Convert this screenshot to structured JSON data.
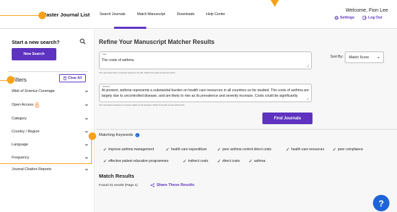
{
  "header": {
    "brand": "Master Journal List",
    "nav": [
      "Search Journals",
      "Match Manuscript",
      "Downloads",
      "Help Center"
    ],
    "welcome": "Welcome, Fion Lee",
    "settings": "Settings",
    "logout": "Log Out"
  },
  "sidebar": {
    "new_search_title": "Start a new search?",
    "new_search_button": "New Search",
    "filters_title": "Filters",
    "clear_all": "Clear All",
    "filters": [
      {
        "label": "Web of Science Coverage",
        "italic": true
      },
      {
        "label": "Open Access",
        "icon": "open-lock-icon"
      },
      {
        "label": "Category"
      },
      {
        "label": "Country / Region"
      },
      {
        "label": "Language"
      },
      {
        "label": "Frequency"
      },
      {
        "label": "Journal Citation Reports"
      }
    ]
  },
  "main": {
    "title": "Refine Your Manuscript Matcher Results",
    "title_field": {
      "label": "Title",
      "value": "The costs of asthma",
      "help": "The manuscript title or relevant part(s) of the title. Works best with at least 10 words."
    },
    "abstract_field": {
      "label": "Abstract",
      "value": "At present, asthma represents a substantial burden on health care resources in all countries so far studied. The costs of asthma are largely due to uncontrolled disease, and are likely to rise as its prevalence and severity increase. Costs could be significantly",
      "help": "The manuscript abstract or relevant part(s) of the abstract. Works best with at least 100 words."
    },
    "sort_by_label": "Sort By:",
    "sort_by_value": "Match Score",
    "find_button": "Find Journals",
    "matching_keywords_title": "Matching Keywords",
    "keywords_row1": [
      "improve asthma management",
      "health care expenditure",
      "poor asthma control-direct costs",
      "health care resources",
      "poor compliance"
    ],
    "keywords_row2": [
      "effective patient education programmes",
      "indirect costs",
      "direct costs",
      "asthma"
    ],
    "match_results_title": "Match Results",
    "found_text": "Found 31 results (Page 1)",
    "share_text": "Share These Results",
    "help_glyph": "?"
  },
  "colors": {
    "accent": "#5e33bf",
    "annotation": "#f7a21b",
    "help": "#1f64d6"
  }
}
